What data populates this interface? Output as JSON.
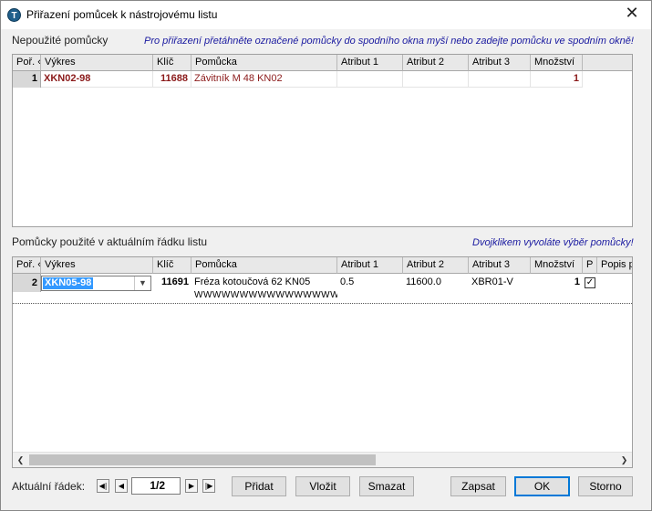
{
  "window": {
    "title": "Přiřazení pomůcek k nástrojovému listu",
    "icon_letter": "T",
    "close_glyph": "✕"
  },
  "top_section": {
    "label": "Nepoužité pomůcky",
    "hint": "Pro přiřazení přetáhněte označené pomůcky do spodního okna myší nebo zadejte pomůcku ve spodním okně!",
    "columns": [
      "Poř. «",
      "Výkres",
      "Klíč",
      "Pomůcka",
      "Atribut 1",
      "Atribut 2",
      "Atribut 3",
      "Množství"
    ],
    "rows": [
      {
        "num": "1",
        "vykres": "XKN02-98",
        "klic": "11688",
        "pomucka": "Závitník M 48 KN02",
        "atr1": "",
        "atr2": "",
        "atr3": "",
        "mnozstvi": "1"
      }
    ]
  },
  "bottom_section": {
    "label": "Pomůcky použité v aktuálním řádku listu",
    "hint": "Dvojklikem vyvoláte výběr pomůcky!",
    "columns": [
      "Poř. «",
      "Výkres",
      "Klíč",
      "Pomůcka",
      "Atribut 1",
      "Atribut 2",
      "Atribut 3",
      "Množství",
      "P",
      "Popis p"
    ],
    "rows": [
      {
        "num": "2",
        "vykres": "XKN05-98",
        "klic": "11691",
        "pomucka": "Fréza kotoučová 62 KN05",
        "pomucka_line2": "WWWWWWWWWWWWWWWW",
        "atr1": "0.5",
        "atr2": "11600.0",
        "atr3": "XBR01-V",
        "mnozstvi": "1",
        "p_checked": "✓",
        "popis": ""
      }
    ]
  },
  "footer": {
    "current_row_label": "Aktuální řádek:",
    "page": "1/2",
    "buttons": {
      "pridat": "Přidat",
      "vlozit": "Vložit",
      "smazat": "Smazat",
      "zapsat": "Zapsat",
      "ok": "OK",
      "storno": "Storno"
    }
  },
  "colors": {
    "accent": "#0078d7",
    "top_row_text": "#8b1a1a",
    "hint_text": "#1a1aa0",
    "selection": "#3399ff"
  }
}
